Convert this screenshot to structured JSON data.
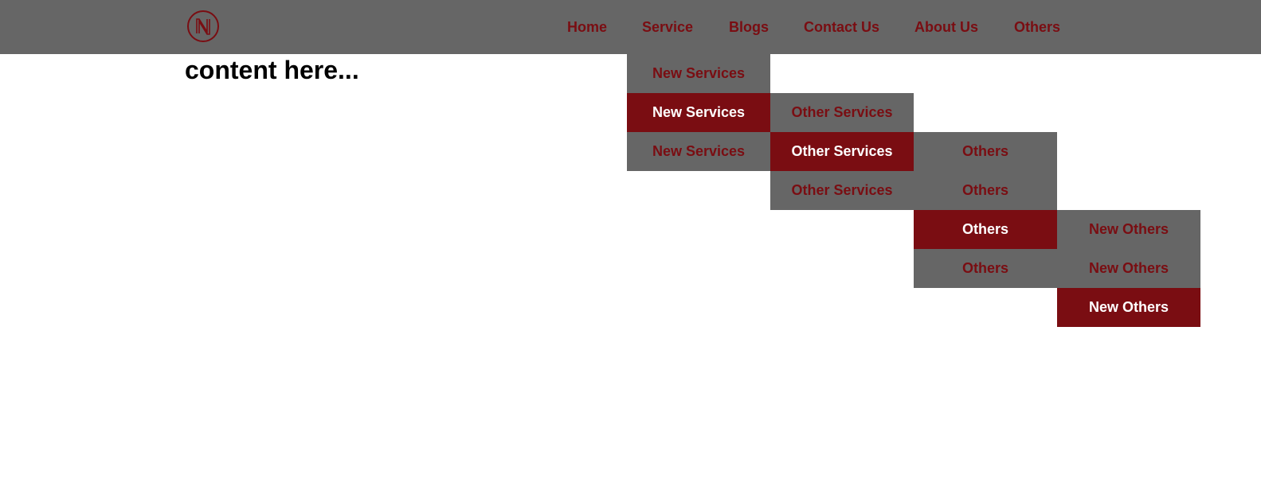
{
  "header": {
    "logo_letter": "N",
    "nav": {
      "home": "Home",
      "service": "Service",
      "blogs": "Blogs",
      "contact": "Contact Us",
      "about": "About Us",
      "others": "Others"
    }
  },
  "main": {
    "heading": "content here..."
  },
  "dropdown": {
    "level1": [
      "New Services",
      "New Services",
      "New Services"
    ],
    "level2": [
      "Other Services",
      "Other Services",
      "Other Services"
    ],
    "level3": [
      "Others",
      "Others",
      "Others",
      "Others"
    ],
    "level4": [
      "New Others",
      "New Others",
      "New Others"
    ]
  },
  "colors": {
    "bar": "#666666",
    "accent": "#7a0d12",
    "active_text": "#ffffff"
  }
}
